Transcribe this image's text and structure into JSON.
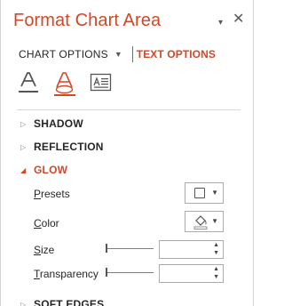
{
  "pane": {
    "title": "Format Chart Area",
    "pin_glyph": "▾",
    "close_glyph": "✕"
  },
  "options": {
    "chart_options_label": "CHART OPTIONS",
    "chart_options_caret": "▼",
    "text_options_label": "TEXT OPTIONS"
  },
  "icon_tabs": [
    "text-fill-outline-icon",
    "text-effects-icon",
    "textbox-icon"
  ],
  "sections": {
    "shadow": "SHADOW",
    "reflection": "REFLECTION",
    "glow": "GLOW",
    "soft_edges": "SOFT EDGES",
    "collapsed_glyph": "▷",
    "expanded_glyph": "◢"
  },
  "glow": {
    "presets": {
      "mnemonic": "P",
      "rest": "resets"
    },
    "color": {
      "mnemonic": "C",
      "rest": "olor"
    },
    "size": {
      "mnemonic": "S",
      "rest": "ize",
      "value": ""
    },
    "transparency": {
      "mnemonic": "T",
      "rest": "ransparency",
      "value": ""
    },
    "caret_glyph": "▼",
    "spin_up": "▲",
    "spin_down": "▼"
  },
  "colors": {
    "accent": "#d24726",
    "text": "#262626",
    "border": "#ababab"
  }
}
